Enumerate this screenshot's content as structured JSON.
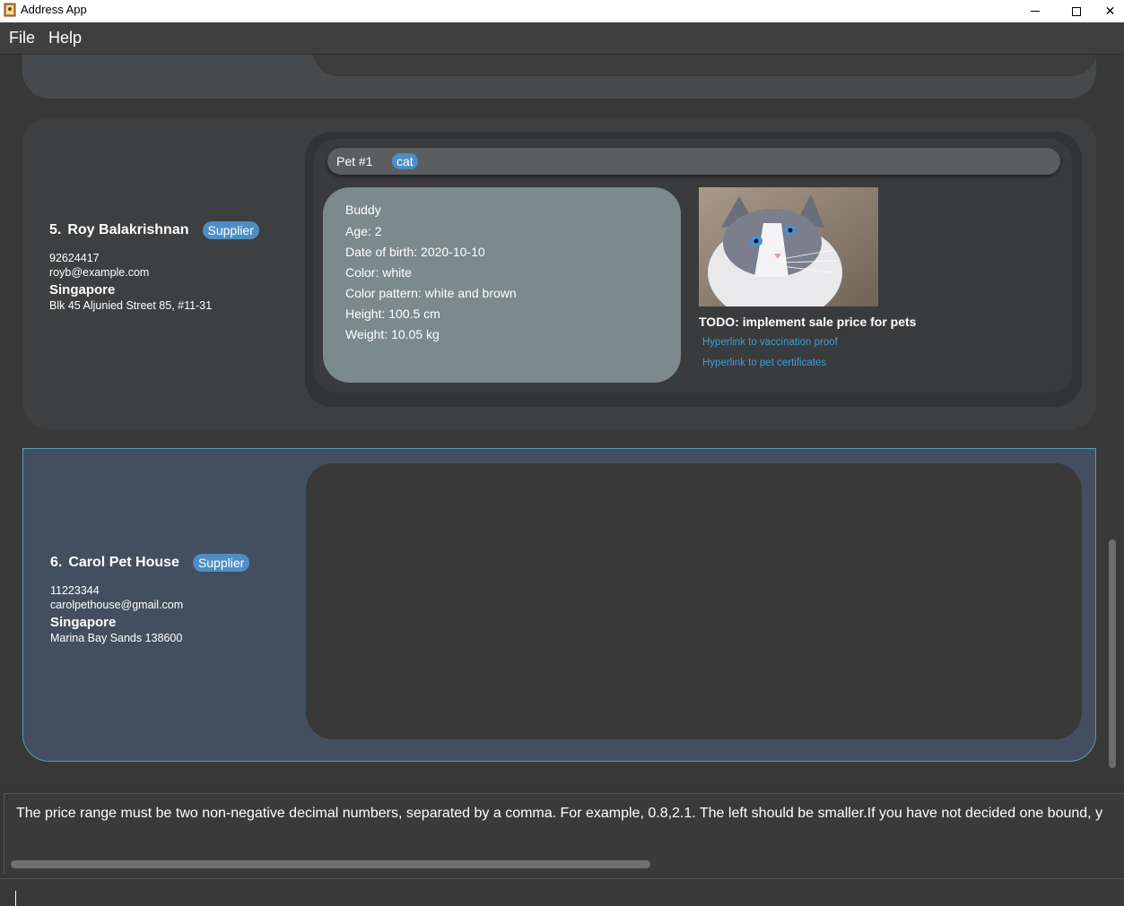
{
  "window": {
    "title": "Address App"
  },
  "menu": {
    "file_label": "File",
    "help_label": "Help"
  },
  "persons": [
    {
      "index": "5.",
      "name": "Roy Balakrishnan",
      "tag": "Supplier",
      "phone": "92624417",
      "email": "royb@example.com",
      "city": "Singapore",
      "address": "Blk 45 Aljunied Street 85, #11-31",
      "pet": {
        "number_label": "Pet #1",
        "tag": "cat",
        "name": "Buddy",
        "age": "Age: 2",
        "dob": "Date of birth: 2020-10-10",
        "color": "Color: white",
        "color_pattern": "Color pattern: white and brown",
        "height": "Height: 100.5 cm",
        "weight": "Weight: 10.05 kg",
        "todo": "TODO: implement sale price for pets",
        "link_vaccination": "Hyperlink to vaccination proof",
        "link_certificates": "Hyperlink to pet certificates"
      }
    },
    {
      "index": "6.",
      "name": "Carol Pet House",
      "tag": "Supplier",
      "phone": "11223344",
      "email": "carolpethouse@gmail.com",
      "city": "Singapore",
      "address": "Marina Bay Sands 138600"
    }
  ],
  "result": {
    "message": "The price range must be two non-negative decimal numbers, separated by a comma. For example, 0.8,2.1. The left should be smaller.If you have not decided one bound, y"
  },
  "command": {
    "value": ""
  },
  "colors": {
    "tag_blue": "#4e8ec4",
    "selected_border": "#4d9fb8",
    "link": "#3a9fd6"
  }
}
